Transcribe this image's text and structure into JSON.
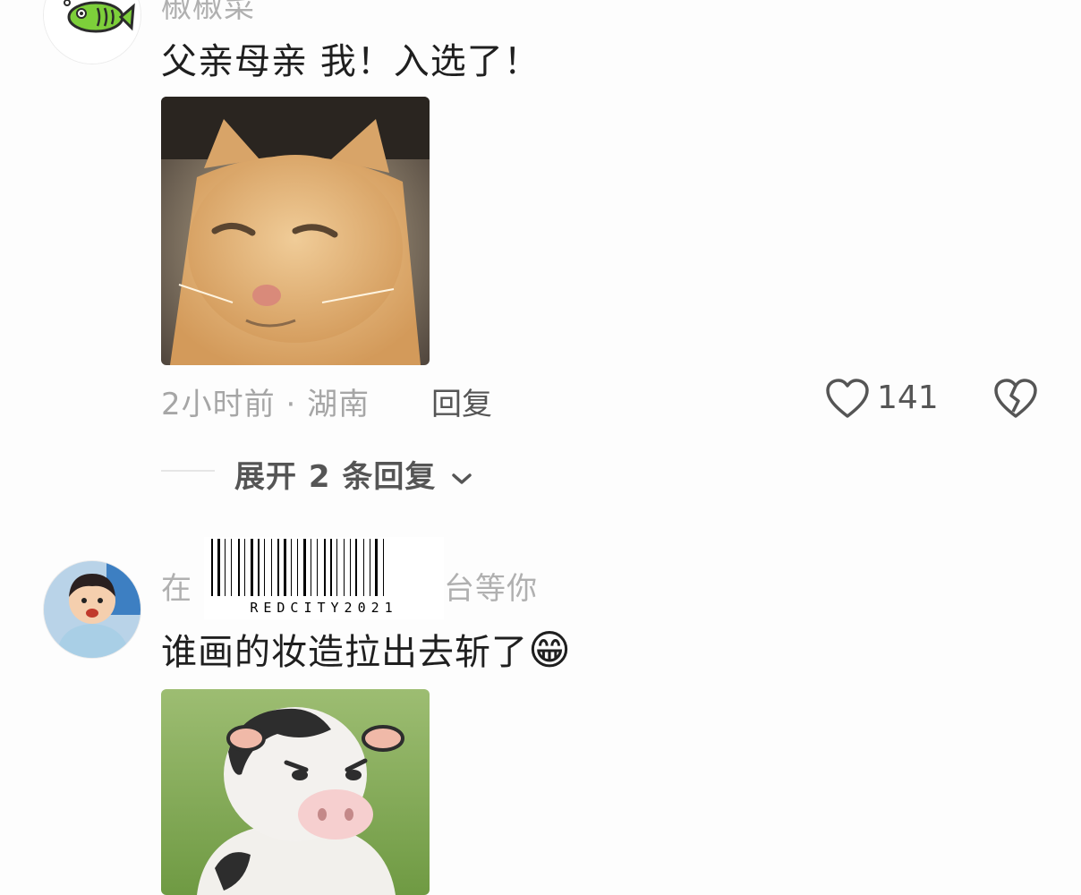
{
  "comments": [
    {
      "username": "椒椒菜",
      "text": "父亲母亲 我！入选了！",
      "image_icon": "cat-meme",
      "time": "2小时前",
      "location": "湖南",
      "reply_label": "回复",
      "likes": "141",
      "expand_label": "展开 2 条回复"
    },
    {
      "username_left": "在",
      "username_right": "台等你",
      "text": "谁画的妆造拉出去斩了",
      "emoji": "😁",
      "image_icon": "cow-meme",
      "watermark": "REDCITY2021"
    }
  ],
  "meta_separator": " · ",
  "colors": {
    "accent_avatar_fish": "#7dcf3a",
    "meta_text": "#a6a6a6"
  }
}
